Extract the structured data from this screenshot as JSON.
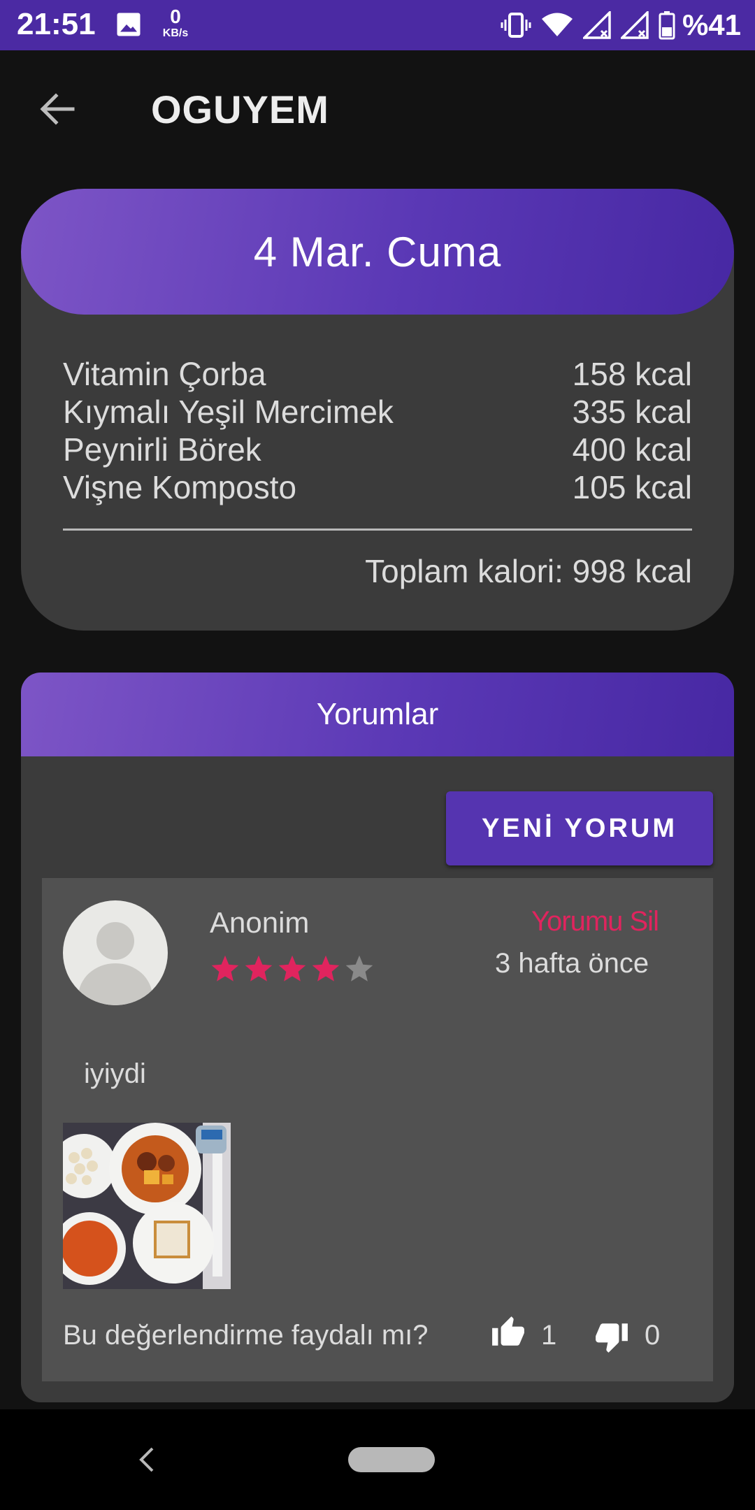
{
  "status_bar": {
    "time": "21:51",
    "net_speed_value": "0",
    "net_speed_unit": "KB/s",
    "battery": "%41",
    "icons": [
      "gallery-icon",
      "vibrate-icon",
      "wifi-icon",
      "signal-icon",
      "signal-icon",
      "battery-icon"
    ],
    "color": "#4b2aa3"
  },
  "app_bar": {
    "title": "OGUYEM",
    "back_icon": "arrow-left-icon"
  },
  "menu": {
    "date": "4 Mar. Cuma",
    "items": [
      {
        "name": "Vitamin Çorba",
        "kcal": "158 kcal"
      },
      {
        "name": "Kıymalı Yeşil Mercimek",
        "kcal": "335 kcal"
      },
      {
        "name": "Peynirli Börek",
        "kcal": "400 kcal"
      },
      {
        "name": "Vişne Komposto",
        "kcal": "105 kcal"
      }
    ],
    "total": "Toplam kalori: 998 kcal"
  },
  "comments": {
    "title": "Yorumlar",
    "new_button": "YENİ YORUM",
    "list": [
      {
        "author": "Anonim",
        "rating": 4,
        "rating_max": 5,
        "delete_label": "Yorumu Sil",
        "time_ago": "3 hafta önce",
        "text": "iyiydi",
        "helpful_question": "Bu değerlendirme faydalı mı?",
        "likes": "1",
        "dislikes": "0"
      }
    ]
  },
  "colors": {
    "accent": "#5534b0",
    "gradient_start": "#7d55c6",
    "gradient_end": "#4728a3",
    "star_active": "#e0245e",
    "star_inactive": "#8a8a8a",
    "delete": "#e0245e"
  }
}
